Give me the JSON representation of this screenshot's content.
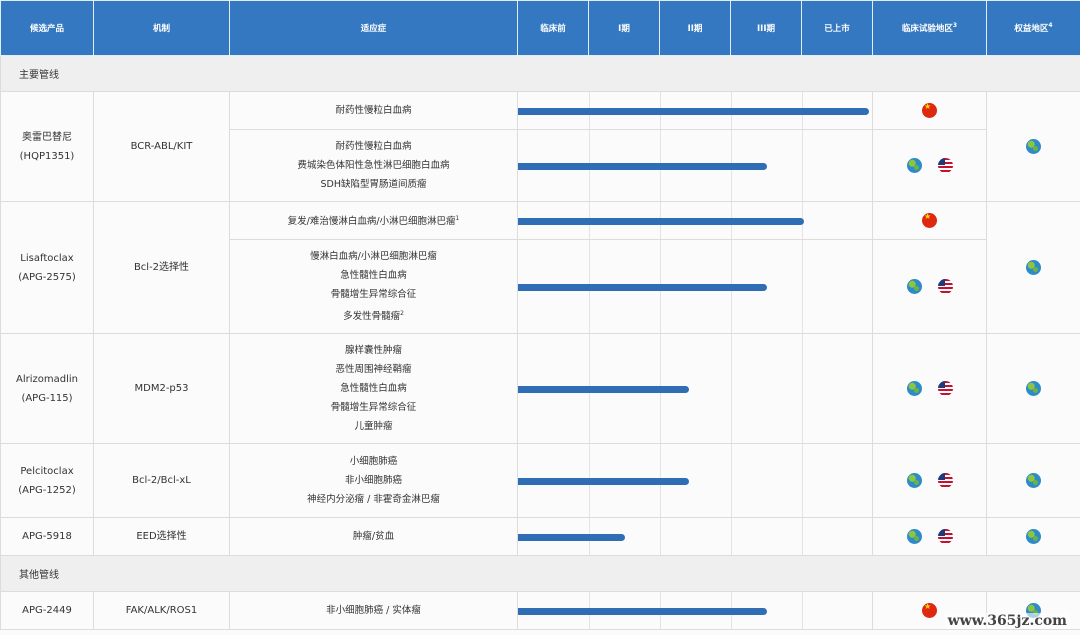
{
  "header": {
    "candidate": "候选产品",
    "mechanism": "机制",
    "indication": "适应症",
    "preclinical": "临床前",
    "phase1": "I期",
    "phase2": "II期",
    "phase3": "III期",
    "marketed": "已上市",
    "trial_region": "临床试验地区",
    "trial_region_sup": "3",
    "rights_region": "权益地区",
    "rights_region_sup": "4"
  },
  "sections": {
    "main": "主要管线",
    "other": "其他管线"
  },
  "rows": [
    {
      "product": [
        "奥雷巴替尼",
        "(HQP1351)"
      ],
      "mechanism": "BCR-ABL/KIT",
      "rights": [
        "globe"
      ],
      "sub": [
        {
          "indications": [
            "耐药性慢粒白血病"
          ],
          "progress": 0.988,
          "trial": [
            "china-flag"
          ]
        },
        {
          "indications": [
            "耐药性慢粒白血病",
            "费城染色体阳性急性淋巴细胞白血病",
            "SDH缺陷型胃肠道间质瘤"
          ],
          "progress": 0.702,
          "trial": [
            "globe",
            "us-flag"
          ]
        }
      ]
    },
    {
      "product": [
        "Lisaftoclax",
        "(APG-2575)"
      ],
      "mechanism": "Bcl-2选择性",
      "rights": [
        "globe"
      ],
      "sub": [
        {
          "indications": [
            "复发/难治慢淋白血病/小淋巴细胞淋巴瘤"
          ],
          "indication_sup": "1",
          "progress": 0.806,
          "trial": [
            "china-flag"
          ]
        },
        {
          "indications": [
            "慢淋白血病/小淋巴细胞淋巴瘤",
            "急性髓性白血病",
            "骨髓增生异常综合征",
            "多发性骨髓瘤"
          ],
          "indication_sup": "2",
          "progress": 0.702,
          "trial": [
            "globe",
            "us-flag"
          ]
        }
      ]
    },
    {
      "product": [
        "Alrizomadlin",
        "(APG-115)"
      ],
      "mechanism": "MDM2-p53",
      "rights": [
        "globe"
      ],
      "sub": [
        {
          "indications": [
            "腺样囊性肿瘤",
            "恶性周围神经鞘瘤",
            "急性髓性白血病",
            "骨髓增生异常综合征",
            "儿童肿瘤"
          ],
          "progress": 0.483,
          "trial": [
            "globe",
            "us-flag"
          ]
        }
      ]
    },
    {
      "product": [
        "Pelcitoclax",
        "(APG-1252)"
      ],
      "mechanism": "Bcl-2/Bcl-xL",
      "rights": [
        "globe"
      ],
      "sub": [
        {
          "indications": [
            "小细胞肺癌",
            "非小细胞肺癌",
            "神经内分泌瘤 / 非霍奇金淋巴瘤"
          ],
          "progress": 0.483,
          "trial": [
            "globe",
            "us-flag"
          ]
        }
      ]
    },
    {
      "product": [
        "APG-5918"
      ],
      "mechanism": "EED选择性",
      "rights": [
        "globe"
      ],
      "sub": [
        {
          "indications": [
            "肿瘤/贫血"
          ],
          "progress": 0.302,
          "trial": [
            "globe",
            "us-flag"
          ]
        }
      ]
    }
  ],
  "other_rows": [
    {
      "product": [
        "APG-2449"
      ],
      "mechanism": "FAK/ALK/ROS1",
      "rights": [
        "globe"
      ],
      "sub": [
        {
          "indications": [
            "非小细胞肺癌 / 实体瘤"
          ],
          "progress": 0.702,
          "trial": [
            "china-flag"
          ]
        }
      ]
    }
  ],
  "watermark": "www.365jz.com",
  "colors": {
    "header_bg": "#3478c1",
    "bar": "#2f6db5",
    "section_bg": "#efefef"
  }
}
